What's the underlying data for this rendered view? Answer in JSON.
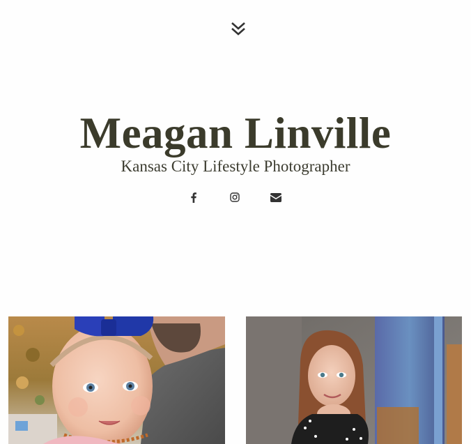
{
  "menu": {
    "icon": "double-chevron-down-icon"
  },
  "header": {
    "title": "Meagan Linville",
    "tagline": "Kansas City Lifestyle Photographer"
  },
  "social": [
    {
      "name": "facebook",
      "icon": "facebook-icon"
    },
    {
      "name": "instagram",
      "icon": "instagram-icon"
    },
    {
      "name": "email",
      "icon": "envelope-icon"
    }
  ],
  "colors": {
    "text": "#3b3b2b",
    "icon": "#333333",
    "background": "#fefefe"
  },
  "gallery": [
    {
      "subject": "baby with blue bow held by man"
    },
    {
      "subject": "girl posing by blue painted post"
    }
  ]
}
